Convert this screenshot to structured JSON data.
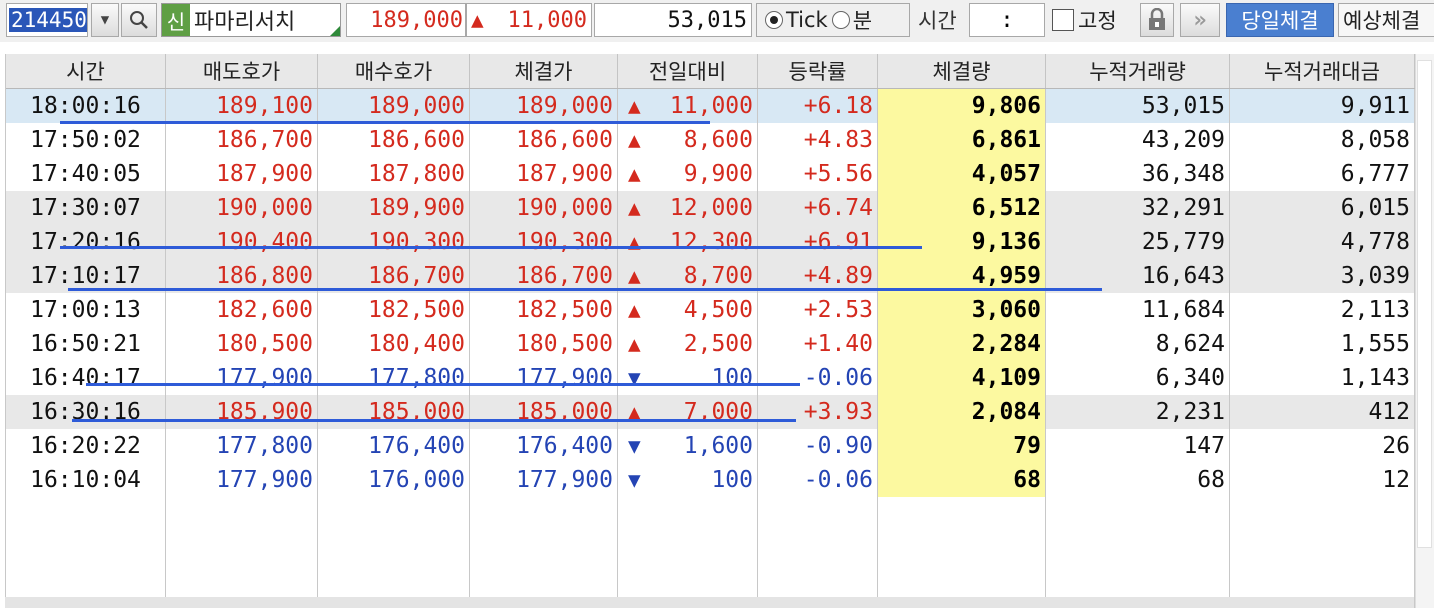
{
  "toolbar": {
    "stock_code": "214450",
    "dropdown_glyph": "▼",
    "search_glyph": "🔍",
    "badge": "신",
    "stock_name": "파마리서치",
    "price": "189,000",
    "change_arrow": "▲",
    "change": "11,000",
    "volume": "53,015",
    "radio_tick": "Tick",
    "radio_min": "분",
    "time_label": "시간",
    "time_value": ":",
    "fixed_label": "고정",
    "ff_glyph": "»",
    "today_button": "당일체결",
    "expected_button": "예상체결"
  },
  "table": {
    "headers": [
      "시간",
      "매도호가",
      "매수호가",
      "체결가",
      "전일대비",
      "등락률",
      "체결량",
      "누적거래량",
      "누적거래대금"
    ],
    "rows": [
      {
        "time": "18:00:16",
        "ask": "189,100",
        "bid": "189,000",
        "price": "189,000",
        "dir": "up",
        "diff": "11,000",
        "rate": "+6.18",
        "vol": "9,806",
        "cum_vol": "53,015",
        "cum_amt": "9,911"
      },
      {
        "time": "17:50:02",
        "ask": "186,700",
        "bid": "186,600",
        "price": "186,600",
        "dir": "up",
        "diff": "8,600",
        "rate": "+4.83",
        "vol": "6,861",
        "cum_vol": "43,209",
        "cum_amt": "8,058"
      },
      {
        "time": "17:40:05",
        "ask": "187,900",
        "bid": "187,800",
        "price": "187,900",
        "dir": "up",
        "diff": "9,900",
        "rate": "+5.56",
        "vol": "4,057",
        "cum_vol": "36,348",
        "cum_amt": "6,777"
      },
      {
        "time": "17:30:07",
        "ask": "190,000",
        "bid": "189,900",
        "price": "190,000",
        "dir": "up",
        "diff": "12,000",
        "rate": "+6.74",
        "vol": "6,512",
        "cum_vol": "32,291",
        "cum_amt": "6,015"
      },
      {
        "time": "17:20:16",
        "ask": "190,400",
        "bid": "190,300",
        "price": "190,300",
        "dir": "up",
        "diff": "12,300",
        "rate": "+6.91",
        "vol": "9,136",
        "cum_vol": "25,779",
        "cum_amt": "4,778"
      },
      {
        "time": "17:10:17",
        "ask": "186,800",
        "bid": "186,700",
        "price": "186,700",
        "dir": "up",
        "diff": "8,700",
        "rate": "+4.89",
        "vol": "4,959",
        "cum_vol": "16,643",
        "cum_amt": "3,039"
      },
      {
        "time": "17:00:13",
        "ask": "182,600",
        "bid": "182,500",
        "price": "182,500",
        "dir": "up",
        "diff": "4,500",
        "rate": "+2.53",
        "vol": "3,060",
        "cum_vol": "11,684",
        "cum_amt": "2,113"
      },
      {
        "time": "16:50:21",
        "ask": "180,500",
        "bid": "180,400",
        "price": "180,500",
        "dir": "up",
        "diff": "2,500",
        "rate": "+1.40",
        "vol": "2,284",
        "cum_vol": "8,624",
        "cum_amt": "1,555"
      },
      {
        "time": "16:40:17",
        "ask": "177,900",
        "bid": "177,800",
        "price": "177,900",
        "dir": "down",
        "diff": "100",
        "rate": "-0.06",
        "vol": "4,109",
        "cum_vol": "6,340",
        "cum_amt": "1,143"
      },
      {
        "time": "16:30:16",
        "ask": "185,900",
        "bid": "185,000",
        "price": "185,000",
        "dir": "up",
        "diff": "7,000",
        "rate": "+3.93",
        "vol": "2,084",
        "cum_vol": "2,231",
        "cum_amt": "412"
      },
      {
        "time": "16:20:22",
        "ask": "177,800",
        "bid": "176,400",
        "price": "176,400",
        "dir": "down",
        "diff": "1,600",
        "rate": "-0.90",
        "vol": "79",
        "cum_vol": "147",
        "cum_amt": "26"
      },
      {
        "time": "16:10:04",
        "ask": "177,900",
        "bid": "176,000",
        "price": "177,900",
        "dir": "down",
        "diff": "100",
        "rate": "-0.06",
        "vol": "68",
        "cum_vol": "68",
        "cum_amt": "12"
      }
    ]
  },
  "colors": {
    "up": "#d42a1e",
    "down": "#2444b4",
    "annotation": "#2e5bd8",
    "volume_bg": "#fcf9a0"
  }
}
